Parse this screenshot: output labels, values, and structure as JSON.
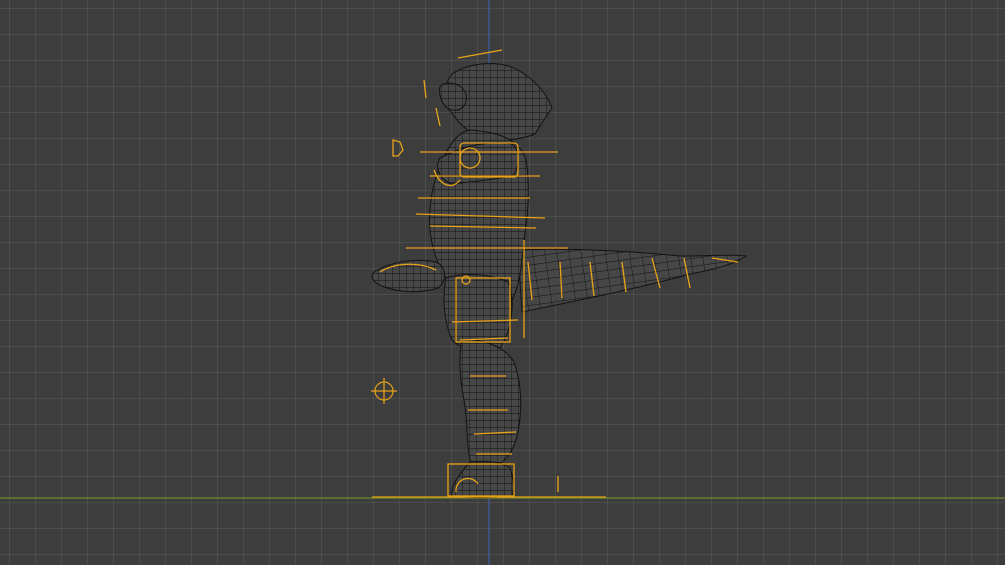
{
  "viewport": {
    "mode": "wireframe-orthographic-side",
    "grid": true,
    "background_color": "#3d3d3d",
    "x_axis_color": "#6f8a2c",
    "z_axis_color": "#3f5fa8",
    "selection_color": "#e8a317",
    "mesh_wire_color": "#111111",
    "mesh_fill_color": "#454545"
  },
  "objects": {
    "mesh": "creature-mesh",
    "rig": "armature",
    "cursor": "3d-cursor-icon"
  }
}
